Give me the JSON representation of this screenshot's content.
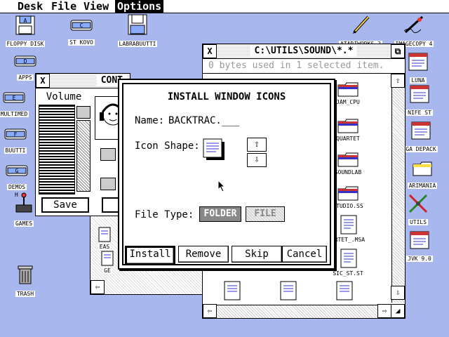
{
  "menubar": {
    "items": [
      {
        "label": "Desk",
        "active": false
      },
      {
        "label": "File",
        "active": false
      },
      {
        "label": "View",
        "active": false
      },
      {
        "label": "Options",
        "active": true
      }
    ]
  },
  "desktop_icons": [
    {
      "label": "FLOPPY DISK",
      "icon": "floppy-icon"
    },
    {
      "label": "ST KOVO",
      "icon": "drive-icon"
    },
    {
      "label": "LABRABUUTTI",
      "icon": "floppy-icon"
    },
    {
      "label": "ATARIWORKS 2",
      "icon": "pencil-icon"
    },
    {
      "label": "IMAGECOPY 4",
      "icon": "pen-icon"
    },
    {
      "label": "APPS",
      "icon": "drive-icon"
    },
    {
      "label": "MULTIMED",
      "icon": "drive-icon"
    },
    {
      "label": "BUUTTI",
      "icon": "drive-icon"
    },
    {
      "label": "DEMOS",
      "icon": "drive-icon"
    },
    {
      "label": "GAMES",
      "icon": "joystick-icon"
    },
    {
      "label": "TRASH",
      "icon": "trash-icon"
    },
    {
      "label": "LUNA",
      "icon": "app-icon"
    },
    {
      "label": "NIFE ST",
      "icon": "app-icon"
    },
    {
      "label": "GA DEPACK",
      "icon": "app-icon"
    },
    {
      "label": "ARIMANIA",
      "icon": "folder-icon"
    },
    {
      "label": "UTILS",
      "icon": "tools-icon"
    },
    {
      "label": "JVK 9.0",
      "icon": "app-icon"
    }
  ],
  "drive_letters": {
    "apps": "D",
    "multimed": "E",
    "buutti": "F",
    "demos": "G",
    "games": "H",
    "stkovo": "C",
    "floppy": "A"
  },
  "control_window": {
    "title": "CONT",
    "volume_label": "Volume",
    "save_label": "Save"
  },
  "file_window": {
    "title": "C:\\UTILS\\SOUND\\*.*",
    "info": "0 bytes used in 1 selected item.",
    "files": [
      {
        "label": "JAM_CPU",
        "type": "folder"
      },
      {
        "label": "QUARTET",
        "type": "folder"
      },
      {
        "label": "SOUNDLAB",
        "type": "folder"
      },
      {
        "label": "STUDIO.SS",
        "type": "folder"
      },
      {
        "label": "ARTET_.MSA",
        "type": "doc"
      },
      {
        "label": "SIC_ST.ST",
        "type": "doc"
      },
      {
        "label": "EAS",
        "type": "doc"
      },
      {
        "label": "GE",
        "type": "doc"
      }
    ]
  },
  "dialog": {
    "title": "INSTALL WINDOW ICONS",
    "name_label": "Name:",
    "name_value": "BACKTRAC.___",
    "icon_shape_label": "Icon Shape:",
    "up_arrow": "⇧",
    "down_arrow": "⇩",
    "file_type_label": "File Type:",
    "type_folder": "FOLDER",
    "type_file": "FILE",
    "buttons": {
      "install": "Install",
      "remove": "Remove",
      "skip": "Skip",
      "cancel": "Cancel"
    }
  },
  "window_controls": {
    "close": "X",
    "full": "⧉",
    "up": "⇧",
    "down": "⇩",
    "left": "⇦",
    "right": "⇨",
    "resize": "◢"
  }
}
